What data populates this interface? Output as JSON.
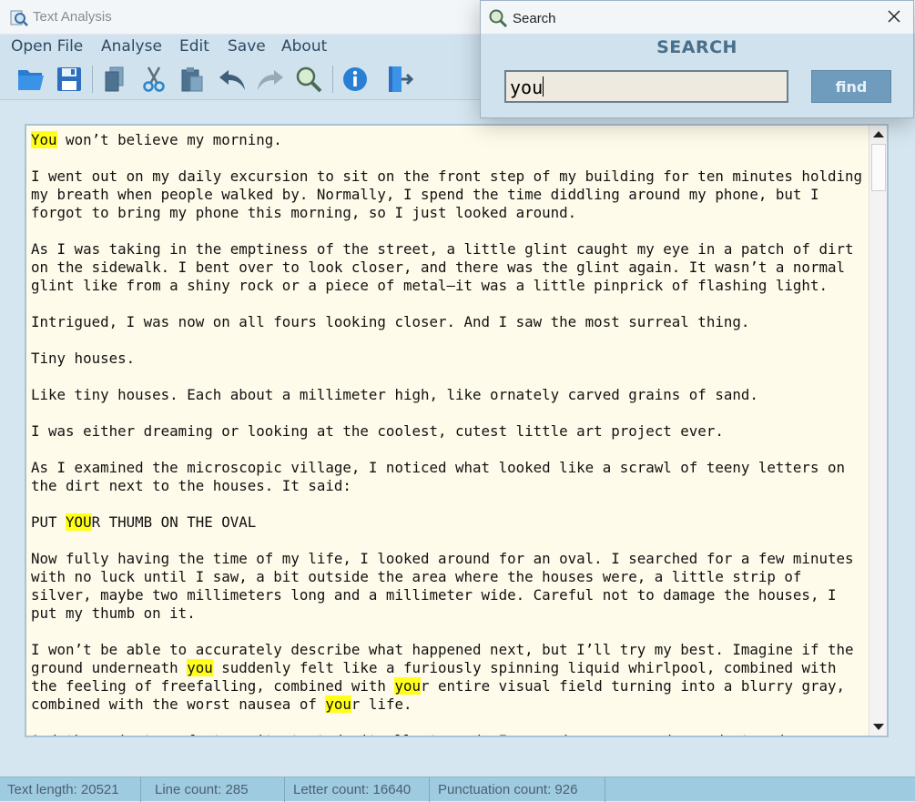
{
  "window": {
    "title": "Text Analysis"
  },
  "menu": [
    "Open File",
    "Analyse",
    "Edit",
    "Save",
    "About"
  ],
  "toolbar": {
    "buttons": [
      "open-folder-icon",
      "save-disk-icon",
      "copy-icon",
      "cut-scissors-icon",
      "paste-clipboard-icon",
      "undo-arrow-icon",
      "redo-arrow-icon",
      "search-magnifier-icon",
      "info-icon",
      "exit-door-icon"
    ]
  },
  "search_dialog": {
    "title": "Search",
    "heading": "SEARCH",
    "query": "you",
    "find_label": "find"
  },
  "document": {
    "highlight_term": "you",
    "lines": [
      "You won’t believe my morning.",
      "",
      "I went out on my daily excursion to sit on the front step of my building for ten minutes holding",
      "my breath when people walked by. Normally, I spend the time diddling around my phone, but I",
      "forgot to bring my phone this morning, so I just looked around.",
      "",
      "As I was taking in the emptiness of the street, a little glint caught my eye in a patch of dirt",
      "on the sidewalk. I bent over to look closer, and there was the glint again. It wasn’t a normal",
      "glint like from a shiny rock or a piece of metal—it was a little pinprick of flashing light.",
      "",
      "Intrigued, I was now on all fours looking closer. And I saw the most surreal thing.",
      "",
      "Tiny houses.",
      "",
      "Like tiny houses. Each about a millimeter high, like ornately carved grains of sand.",
      "",
      "I was either dreaming or looking at the coolest, cutest little art project ever.",
      "",
      "As I examined the microscopic village, I noticed what looked like a scrawl of teeny letters on",
      "the dirt next to the houses. It said:",
      "",
      "PUT YOUR THUMB ON THE OVAL",
      "",
      "Now fully having the time of my life, I looked around for an oval. I searched for a few minutes",
      "with no luck until I saw, a bit outside the area where the houses were, a little strip of",
      "silver, maybe two millimeters long and a millimeter wide. Careful not to damage the houses, I",
      "put my thumb on it.",
      "",
      "I won’t be able to accurately describe what happened next, but I’ll try my best. Imagine if the",
      "ground underneath you suddenly felt like a furiously spinning liquid whirlpool, combined with",
      "the feeling of freefalling, combined with your entire visual field turning into a blurry gray,",
      "combined with the worst nausea of your life.",
      "",
      "And then, just as fast as it started, it all stopped. I opened my eyes and saw dust and"
    ]
  },
  "status": {
    "text_length": "Text length: 20521",
    "line_count": "Line count: 285",
    "letter_count": "Letter count: 16640",
    "punctuation_count": "Punctuation count: 926"
  },
  "colors": {
    "highlight": "#ffff1a",
    "editor_bg": "#fffbea",
    "statusbar": "#9fcbe0",
    "find_button": "#6f9cbd"
  }
}
